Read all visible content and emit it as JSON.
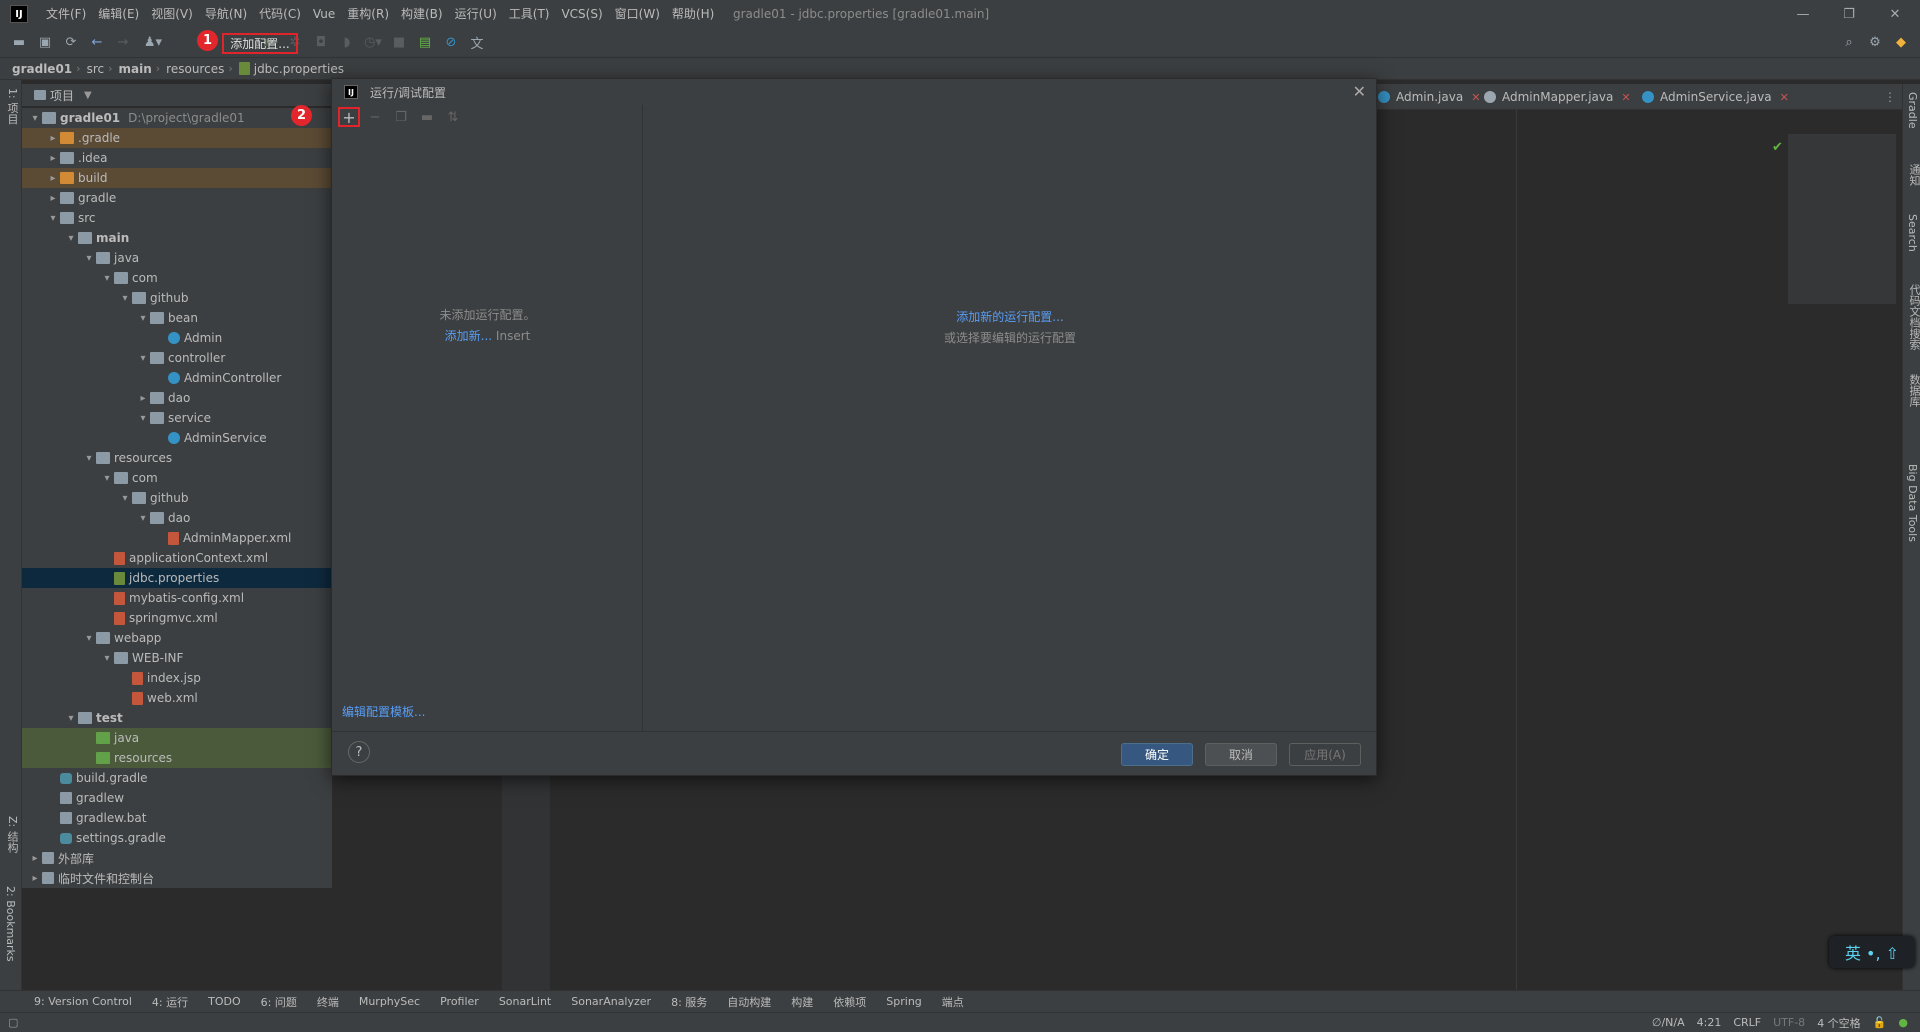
{
  "app": {
    "window_title": "gradle01 - jdbc.properties [gradle01.main]",
    "logo": "IJ"
  },
  "menu": [
    "文件(F)",
    "编辑(E)",
    "视图(V)",
    "导航(N)",
    "代码(C)",
    "Vue",
    "重构(R)",
    "构建(B)",
    "运行(U)",
    "工具(T)",
    "VCS(S)",
    "窗口(W)",
    "帮助(H)"
  ],
  "toolbar": {
    "add_config_label": "添加配置...",
    "badge1": "1",
    "badge2": "2"
  },
  "breadcrumb": [
    "gradle01",
    "src",
    "main",
    "resources",
    "jdbc.properties"
  ],
  "left_strip": {
    "project": "1: 项目",
    "structure": "Z: 结构",
    "bookmarks": "2: Bookmarks"
  },
  "project_panel": {
    "title": "项目"
  },
  "tree": [
    {
      "label": "gradle01",
      "hint": "D:\\project\\gradle01",
      "depth": 0,
      "arrow": "v",
      "icon": "folder",
      "hl": "",
      "bold": true
    },
    {
      "label": ".gradle",
      "depth": 1,
      "arrow": ">",
      "icon": "folder orange",
      "hl": "hl-brown"
    },
    {
      "label": ".idea",
      "depth": 1,
      "arrow": ">",
      "icon": "folder",
      "hl": ""
    },
    {
      "label": "build",
      "depth": 1,
      "arrow": ">",
      "icon": "folder orange",
      "hl": "hl-brown"
    },
    {
      "label": "gradle",
      "depth": 1,
      "arrow": ">",
      "icon": "folder",
      "hl": ""
    },
    {
      "label": "src",
      "depth": 1,
      "arrow": "v",
      "icon": "folder",
      "hl": ""
    },
    {
      "label": "main",
      "depth": 2,
      "arrow": "v",
      "icon": "folder",
      "hl": "",
      "bold": true
    },
    {
      "label": "java",
      "depth": 3,
      "arrow": "v",
      "icon": "folder",
      "hl": ""
    },
    {
      "label": "com",
      "depth": 4,
      "arrow": "v",
      "icon": "folder",
      "hl": ""
    },
    {
      "label": "github",
      "depth": 5,
      "arrow": "v",
      "icon": "folder",
      "hl": ""
    },
    {
      "label": "bean",
      "depth": 6,
      "arrow": "v",
      "icon": "folder",
      "hl": ""
    },
    {
      "label": "Admin",
      "depth": 7,
      "arrow": "",
      "icon": "cls",
      "hl": ""
    },
    {
      "label": "controller",
      "depth": 6,
      "arrow": "v",
      "icon": "folder",
      "hl": ""
    },
    {
      "label": "AdminController",
      "depth": 7,
      "arrow": "",
      "icon": "cls",
      "hl": ""
    },
    {
      "label": "dao",
      "depth": 6,
      "arrow": ">",
      "icon": "folder",
      "hl": ""
    },
    {
      "label": "service",
      "depth": 6,
      "arrow": "v",
      "icon": "folder",
      "hl": ""
    },
    {
      "label": "AdminService",
      "depth": 7,
      "arrow": "",
      "icon": "cls",
      "hl": ""
    },
    {
      "label": "resources",
      "depth": 3,
      "arrow": "v",
      "icon": "folder",
      "hl": ""
    },
    {
      "label": "com",
      "depth": 4,
      "arrow": "v",
      "icon": "folder",
      "hl": ""
    },
    {
      "label": "github",
      "depth": 5,
      "arrow": "v",
      "icon": "folder",
      "hl": ""
    },
    {
      "label": "dao",
      "depth": 6,
      "arrow": "v",
      "icon": "folder",
      "hl": ""
    },
    {
      "label": "AdminMapper.xml",
      "depth": 7,
      "arrow": "",
      "icon": "xml",
      "hl": ""
    },
    {
      "label": "applicationContext.xml",
      "depth": 4,
      "arrow": "",
      "icon": "xml",
      "hl": ""
    },
    {
      "label": "jdbc.properties",
      "depth": 4,
      "arrow": "",
      "icon": "prop",
      "hl": "sel"
    },
    {
      "label": "mybatis-config.xml",
      "depth": 4,
      "arrow": "",
      "icon": "xml",
      "hl": ""
    },
    {
      "label": "springmvc.xml",
      "depth": 4,
      "arrow": "",
      "icon": "xml",
      "hl": ""
    },
    {
      "label": "webapp",
      "depth": 3,
      "arrow": "v",
      "icon": "folder",
      "hl": ""
    },
    {
      "label": "WEB-INF",
      "depth": 4,
      "arrow": "v",
      "icon": "folder",
      "hl": ""
    },
    {
      "label": "index.jsp",
      "depth": 5,
      "arrow": "",
      "icon": "xml",
      "hl": ""
    },
    {
      "label": "web.xml",
      "depth": 5,
      "arrow": "",
      "icon": "xml",
      "hl": ""
    },
    {
      "label": "test",
      "depth": 2,
      "arrow": "v",
      "icon": "folder",
      "hl": "",
      "bold": true
    },
    {
      "label": "java",
      "depth": 3,
      "arrow": "",
      "icon": "folder green",
      "hl": "hl-green"
    },
    {
      "label": "resources",
      "depth": 3,
      "arrow": "",
      "icon": "folder green",
      "hl": "hl-green"
    },
    {
      "label": "build.gradle",
      "depth": 1,
      "arrow": "",
      "icon": "grad",
      "hl": ""
    },
    {
      "label": "gradlew",
      "depth": 1,
      "arrow": "",
      "icon": "lib",
      "hl": ""
    },
    {
      "label": "gradlew.bat",
      "depth": 1,
      "arrow": "",
      "icon": "lib",
      "hl": ""
    },
    {
      "label": "settings.gradle",
      "depth": 1,
      "arrow": "",
      "icon": "grad",
      "hl": ""
    },
    {
      "label": "外部库",
      "depth": 0,
      "arrow": ">",
      "icon": "lib",
      "hl": ""
    },
    {
      "label": "临时文件和控制台",
      "depth": 0,
      "arrow": ">",
      "icon": "lib",
      "hl": ""
    }
  ],
  "editor_tabs": [
    "Admin.java",
    "AdminMapper.java",
    "AdminService.java"
  ],
  "right_strip": [
    "Gradle",
    "通知",
    "Search",
    "代码文档搜索",
    "数据库",
    "Big Data Tools"
  ],
  "dialog": {
    "title": "运行/调试配置",
    "empty_left": "未添加运行配置。",
    "add_new_link": "添加新...",
    "insert_hint": "Insert",
    "add_new_config_link": "添加新的运行配置...",
    "or_select": "或选择要编辑的运行配置",
    "edit_templates": "编辑配置模板...",
    "help": "?",
    "ok": "确定",
    "cancel": "取消",
    "apply": "应用(A)"
  },
  "bottom_tools": [
    "9: Version Control",
    "4: 运行",
    "TODO",
    "6: 问题",
    "终端",
    "MurphySec",
    "Profiler",
    "SonarLint",
    "SonarAnalyzer",
    "8: 服务",
    "自动构建",
    "构建",
    "依赖项",
    "Spring",
    "端点"
  ],
  "status": {
    "vcs": "∅/N/A",
    "pos": "4:21",
    "eol": "CRLF",
    "enc": "UTF-8",
    "indent": "4 个空格"
  },
  "ime": "英 •, ⇧"
}
